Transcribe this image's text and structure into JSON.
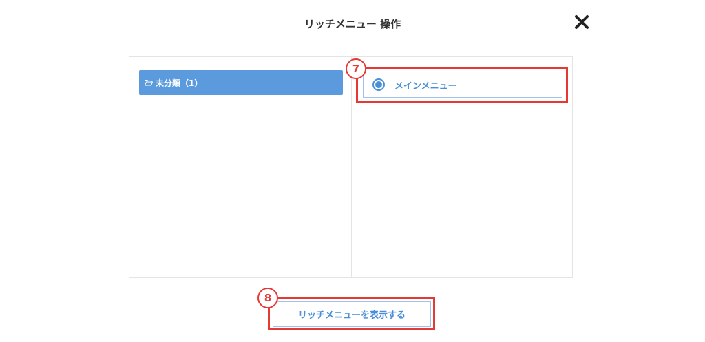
{
  "dialog": {
    "title": "リッチメニュー 操作",
    "close_icon": "close-icon"
  },
  "folders": [
    {
      "label": "未分類（1）",
      "icon": "folder-open-icon",
      "selected": true
    }
  ],
  "menus": [
    {
      "label": "メインメニュー",
      "selected": true
    }
  ],
  "actions": {
    "show_button_label": "リッチメニューを表示する"
  },
  "annotations": {
    "badge_7": "7",
    "badge_8": "8",
    "highlight_color": "#e53935"
  },
  "colors": {
    "accent": "#5b9bdd",
    "accent_text": "#4a8fd8",
    "border": "#e4e4e4"
  }
}
